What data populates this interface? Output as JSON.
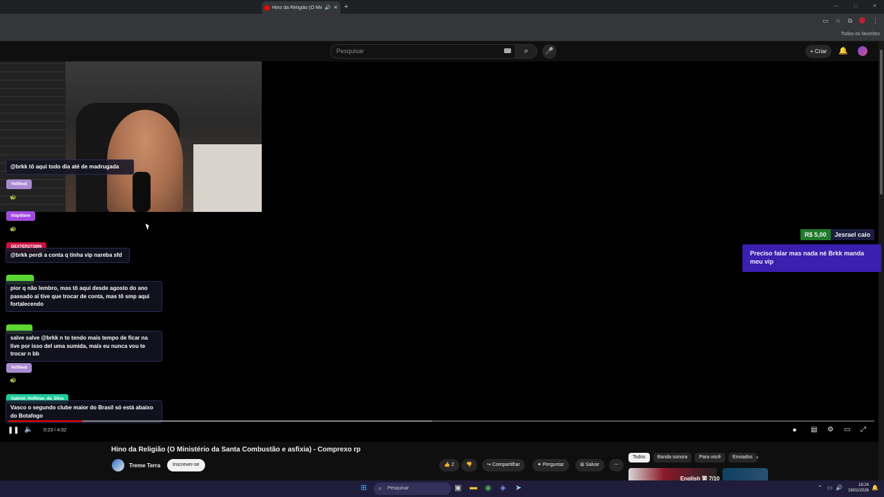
{
  "browser": {
    "tab_title": "Hino da Religião (O Ministér",
    "new_tab": "+",
    "bookmarks_all": "Todos os favoritos",
    "close_tab": "✕"
  },
  "header": {
    "search_placeholder": "Pesquisar",
    "create_label": "Criar"
  },
  "chat": {
    "messages": [
      {
        "user": "@brkk tô aqui todo dia até de madrugada"
      },
      {
        "user": "Voltbeat"
      },
      {
        "user": "tilapidano"
      },
      {
        "user": "DEXTER273899",
        "text": "@brkk perdi a conta q tinha vip nareba sfd"
      },
      {
        "text": "pior q não lembro, mas tô aqui desde agosto do ano passado aí tive que trocar de conta, mas tô smp aqui fortalecendo"
      },
      {
        "text": "salve salve @brkk n to tendo mais tempo de ficar na live por isso del uma sumida, mais eu nunca vou te trocar n bb"
      },
      {
        "user": "Voltbeat"
      },
      {
        "user": "Gabriel_Hoffman_da_Silva",
        "text": "Vasco o segundo clube maior do Brasil só está abaixo do Botafogo"
      }
    ]
  },
  "donation": {
    "amount": "R$ 5,00",
    "donor": "Jesrael caio",
    "message": "Preciso falar mas nada né Brkk manda meu vip"
  },
  "player": {
    "time": "0:23 / 4:32",
    "played_fraction": 0.085,
    "buffered_fraction": 0.49
  },
  "video": {
    "title": "Hino da Religião (O Ministério da Santa Combustão e asfixia) - Comprexo rp",
    "channel": "Treme Terra",
    "subscribe": "Inscrever-se",
    "likes": "2",
    "share": "Compartilhar",
    "ask": "Perguntar",
    "save": "Salvar"
  },
  "chips": [
    "Todos",
    "Banda sonora",
    "Para você",
    "Enviados"
  ],
  "thumb_text": "English 第 7/10",
  "taskbar": {
    "search": "Pesquisar",
    "time": "18:24",
    "date": "19/02/2026"
  },
  "colors": {
    "accent_red": "#ff0000",
    "donation_green": "#1f7a2b",
    "donation_purple": "#3a1fb0",
    "name_purple": "#a14ae0",
    "name_red": "#d01040",
    "name_green": "#5cd630",
    "name_teal": "#1ecb9a"
  }
}
